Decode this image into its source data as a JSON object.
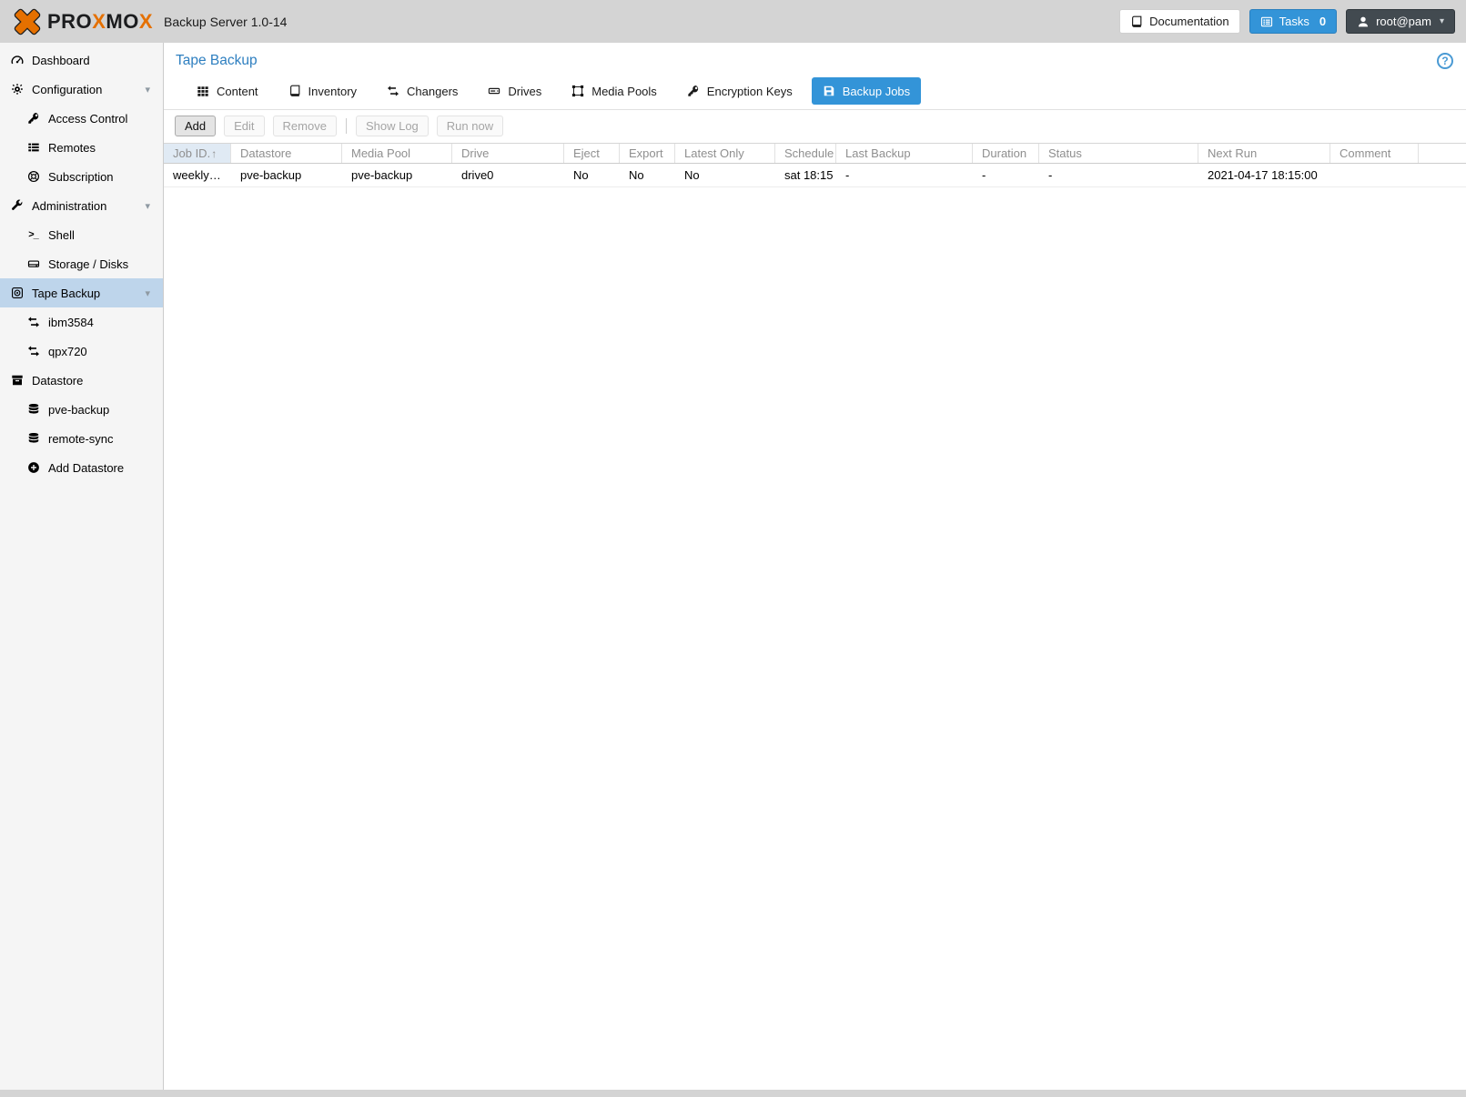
{
  "colors": {
    "accent_blue": "#3394d8",
    "brand_orange": "#E57000",
    "title_blue": "#2e7fc0",
    "sidebar_selected": "#bed5eb",
    "sorted_header_bg": "#e0eaf4",
    "user_button_bg": "#424a50"
  },
  "topbar": {
    "logo_word": [
      {
        "text": "PRO",
        "orange": false
      },
      {
        "text": "X",
        "orange": true
      },
      {
        "text": "MO",
        "orange": false
      },
      {
        "text": "X",
        "orange": true
      }
    ],
    "product": "Backup Server 1.0-14",
    "documentation_label": "Documentation",
    "tasks_label": "Tasks",
    "tasks_count": "0",
    "user_label": "root@pam"
  },
  "sidebar": {
    "items": [
      {
        "label": "Dashboard",
        "icon": "dashboard-icon",
        "level": 0
      },
      {
        "label": "Configuration",
        "icon": "gears-icon",
        "level": 0,
        "expandable": true
      },
      {
        "label": "Access Control",
        "icon": "key-icon",
        "level": 1
      },
      {
        "label": "Remotes",
        "icon": "list-icon",
        "level": 1
      },
      {
        "label": "Subscription",
        "icon": "support-icon",
        "level": 1
      },
      {
        "label": "Administration",
        "icon": "wrench-icon",
        "level": 0,
        "expandable": true
      },
      {
        "label": "Shell",
        "icon": "terminal-icon",
        "level": 1
      },
      {
        "label": "Storage / Disks",
        "icon": "disks-icon",
        "level": 1
      },
      {
        "label": "Tape Backup",
        "icon": "tape-icon",
        "level": 0,
        "expandable": true,
        "selected": true
      },
      {
        "label": "ibm3584",
        "icon": "changer-icon",
        "level": 1
      },
      {
        "label": "qpx720",
        "icon": "changer-icon",
        "level": 1
      },
      {
        "label": "Datastore",
        "icon": "datastore-icon",
        "level": 0
      },
      {
        "label": "pve-backup",
        "icon": "database-icon",
        "level": 1
      },
      {
        "label": "remote-sync",
        "icon": "database-icon",
        "level": 1
      },
      {
        "label": "Add Datastore",
        "icon": "add-icon",
        "level": 1
      }
    ]
  },
  "content": {
    "title": "Tape Backup",
    "help_label": "?",
    "tabs": [
      {
        "label": "Content",
        "icon": "grid-icon"
      },
      {
        "label": "Inventory",
        "icon": "book-icon"
      },
      {
        "label": "Changers",
        "icon": "exchange-icon"
      },
      {
        "label": "Drives",
        "icon": "drive-icon"
      },
      {
        "label": "Media Pools",
        "icon": "object-group-icon"
      },
      {
        "label": "Encryption Keys",
        "icon": "key-icon"
      },
      {
        "label": "Backup Jobs",
        "icon": "floppy-icon",
        "active": true
      }
    ],
    "toolbar": {
      "add": "Add",
      "edit": "Edit",
      "remove": "Remove",
      "show_log": "Show Log",
      "run_now": "Run now"
    },
    "table": {
      "sort_indicator": "↑",
      "columns": [
        "Job ID.",
        "Datastore",
        "Media Pool",
        "Drive",
        "Eject",
        "Export",
        "Latest Only",
        "Schedule",
        "Last Backup",
        "Duration",
        "Status",
        "Next Run",
        "Comment"
      ],
      "rows": [
        [
          "weekly…",
          "pve-backup",
          "pve-backup",
          "drive0",
          "No",
          "No",
          "No",
          "sat 18:15",
          "-",
          "-",
          "-",
          "2021-04-17 18:15:00",
          ""
        ]
      ]
    }
  }
}
